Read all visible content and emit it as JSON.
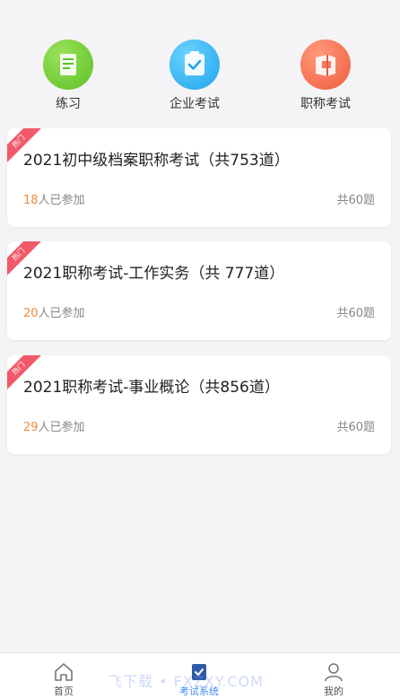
{
  "categories": [
    {
      "label": "练习",
      "icon": "book-icon",
      "color": "#6fcc36"
    },
    {
      "label": "企业考试",
      "icon": "clipboard-check-icon",
      "color": "#2eaaf0"
    },
    {
      "label": "职称考试",
      "icon": "folder-icon",
      "color": "#f26a4d"
    }
  ],
  "exams": [
    {
      "badge": "热门",
      "title": "2021初中级档案职称考试（共753道）",
      "participants": "18",
      "participants_suffix": "人已参加",
      "total": "共60题"
    },
    {
      "badge": "热门",
      "title": "2021职称考试-工作实务（共 777道）",
      "participants": "20",
      "participants_suffix": "人已参加",
      "total": "共60题"
    },
    {
      "badge": "热门",
      "title": "2021职称考试-事业概论（共856道）",
      "participants": "29",
      "participants_suffix": "人已参加",
      "total": "共60题"
    }
  ],
  "tabbar": [
    {
      "label": "首页",
      "icon": "home-icon",
      "active": false
    },
    {
      "label": "考试系统",
      "icon": "exam-icon",
      "active": true
    },
    {
      "label": "我的",
      "icon": "user-icon",
      "active": false
    }
  ],
  "watermark": "飞下载 • FXZXY.COM",
  "colors": {
    "accent": "#3a8df6",
    "highlight": "#f08a3c",
    "ribbon": "#f25a6a",
    "background": "#f4f4f6"
  }
}
